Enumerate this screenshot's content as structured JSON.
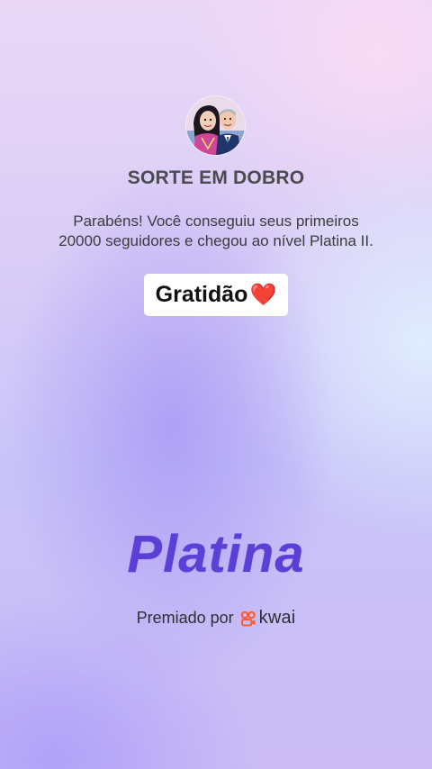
{
  "title": "SORTE EM DOBRO",
  "message": "Parabéns! Você conseguiu seus primeiros 20000 seguidores e chegou ao nível Platina II.",
  "badge": {
    "text": "Gratidão",
    "emoji": "❤️"
  },
  "level_name": "Platina",
  "footer": {
    "prefix": "Premiado por",
    "brand": "kwai",
    "brand_icon": "kwai-logo-icon",
    "brand_color": "#ff5a2c"
  },
  "colors": {
    "level_text": "#5b3fd6",
    "title_text": "#4a4a4f"
  }
}
